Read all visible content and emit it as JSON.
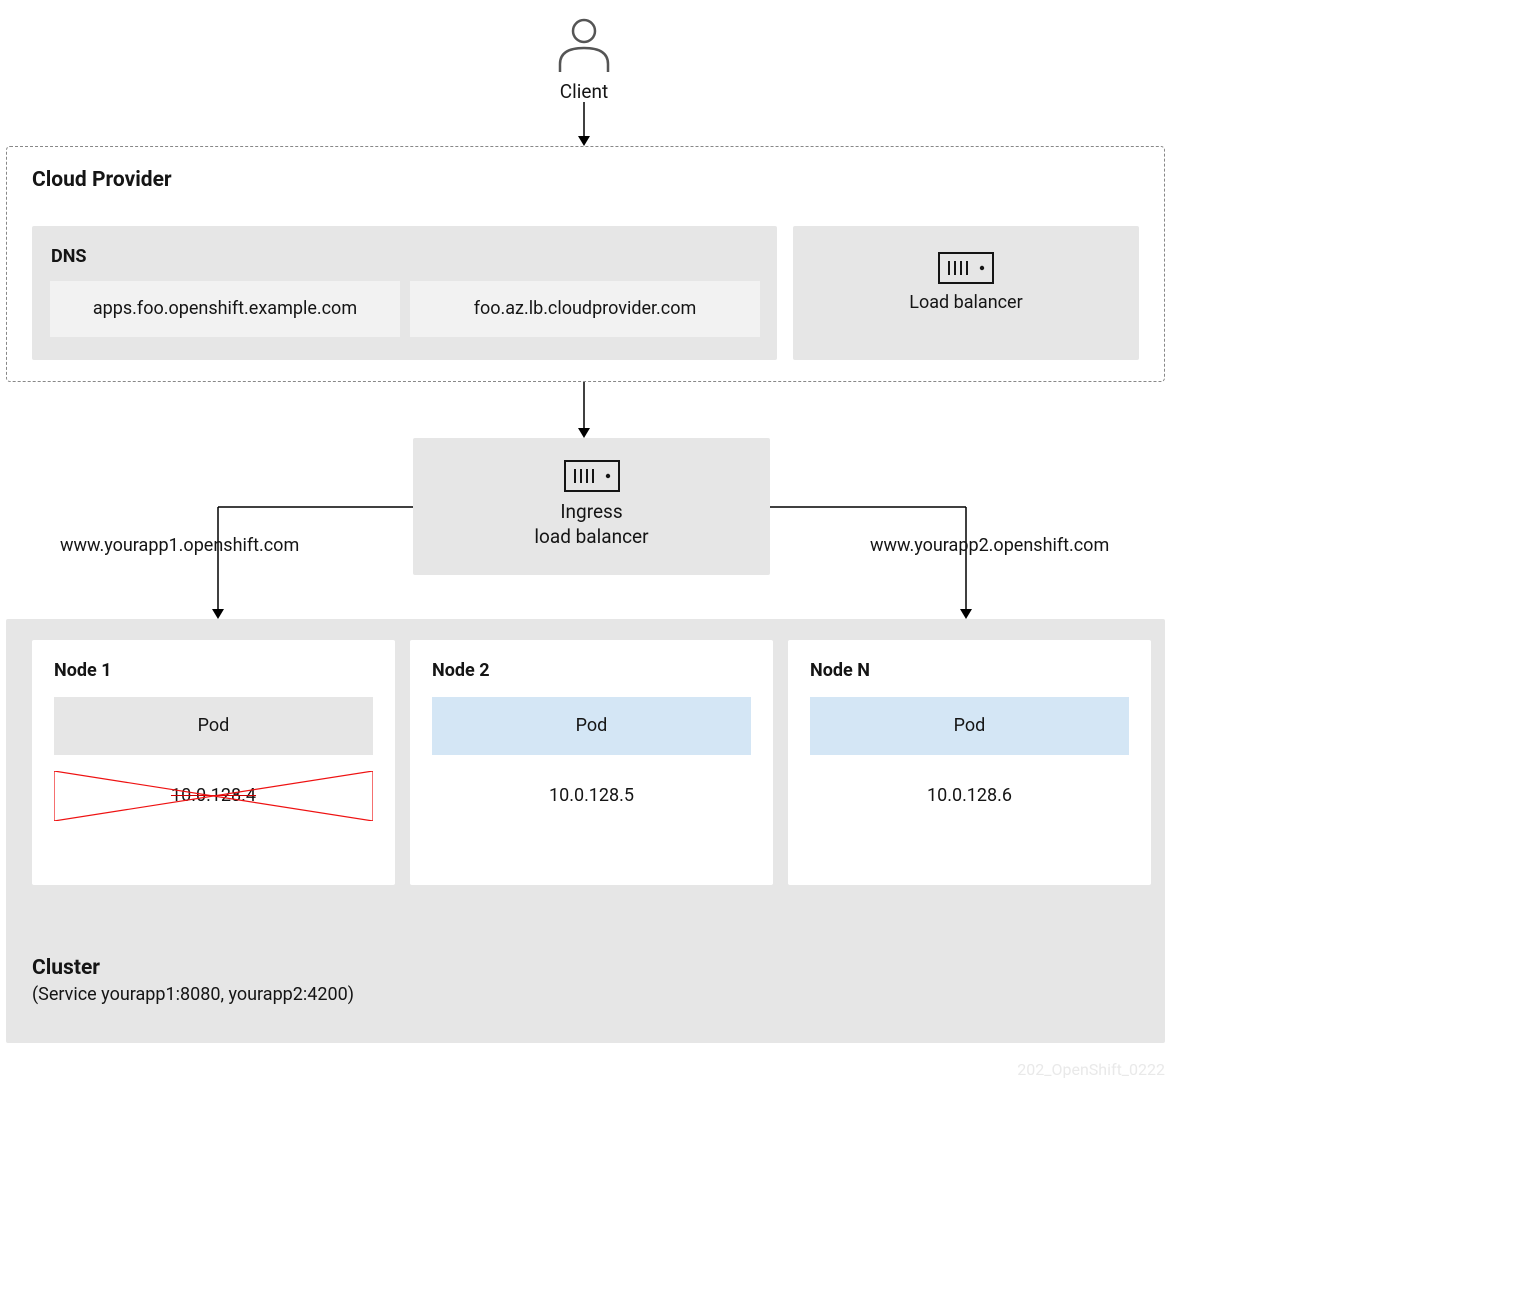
{
  "client": {
    "label": "Client"
  },
  "cloud_provider": {
    "title": "Cloud Provider",
    "dns": {
      "title": "DNS",
      "records": [
        "apps.foo.openshift.example.com",
        "foo.az.lb.cloudprovider.com"
      ]
    },
    "load_balancer": {
      "label": "Load balancer"
    }
  },
  "ingress": {
    "label_line1": "Ingress",
    "label_line2": "load balancer"
  },
  "routes": {
    "left": "www.yourapp1.openshift.com",
    "right": "www.yourapp2.openshift.com"
  },
  "cluster": {
    "title": "Cluster",
    "subtitle": "(Service yourapp1:8080, yourapp2:4200)",
    "nodes": [
      {
        "title": "Node 1",
        "pod": "Pod",
        "ip": "10.0.128.4",
        "active": false
      },
      {
        "title": "Node 2",
        "pod": "Pod",
        "ip": "10.0.128.5",
        "active": true
      },
      {
        "title": "Node N",
        "pod": "Pod",
        "ip": "10.0.128.6",
        "active": true
      }
    ]
  },
  "footnote": "202_OpenShift_0222"
}
